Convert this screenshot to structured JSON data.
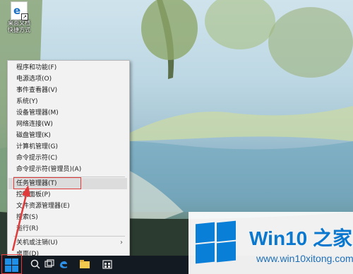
{
  "desktop": {
    "icon_label_1": "桌面文档",
    "icon_label_2": "快捷方式"
  },
  "context_menu": {
    "items": [
      {
        "label": "程序和功能(F)"
      },
      {
        "label": "电源选项(O)"
      },
      {
        "label": "事件查看器(V)"
      },
      {
        "label": "系统(Y)"
      },
      {
        "label": "设备管理器(M)"
      },
      {
        "label": "网络连接(W)"
      },
      {
        "label": "磁盘管理(K)"
      },
      {
        "label": "计算机管理(G)"
      },
      {
        "label": "命令提示符(C)"
      },
      {
        "label": "命令提示符(管理员)(A)"
      },
      {
        "label": "任务管理器(T)"
      },
      {
        "label": "控制面板(P)"
      },
      {
        "label": "文件资源管理器(E)"
      },
      {
        "label": "搜索(S)"
      },
      {
        "label": "运行(R)"
      },
      {
        "label": "关机或注销(U)"
      },
      {
        "label": "桌面(D)"
      }
    ],
    "highlighted": "任务管理器(T)",
    "submenu_chevron": "›"
  },
  "logo": {
    "title": "Win10 之家",
    "url": "www.win10xitong.com"
  },
  "colors": {
    "accent_blue": "#0a7fd8",
    "highlight_red": "#e03a3a",
    "taskbar": "#141a22"
  }
}
